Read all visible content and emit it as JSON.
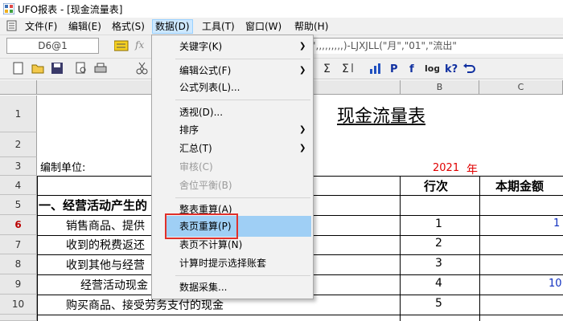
{
  "window": {
    "title": "UFO报表 - [现金流量表]"
  },
  "menubar": {
    "items": [
      "文件(F)",
      "编辑(E)",
      "格式(S)",
      "数据(D)",
      "工具(T)",
      "窗口(W)",
      "帮助(H)"
    ],
    "open_item": "数据(D)"
  },
  "formula_bar": {
    "cell_ref": "D6@1",
    "formula_text": "入\",,,,,,,,,)-LJXJLL(\"月\",\"01\",\"流出\""
  },
  "data_menu": {
    "items": [
      {
        "label": "关键字(K)",
        "submenu": true,
        "enabled": true
      },
      {
        "label": "编辑公式(F)",
        "submenu": true,
        "enabled": true
      },
      {
        "label": "公式列表(L)...",
        "submenu": false,
        "enabled": true
      },
      {
        "label": "透视(D)...",
        "submenu": false,
        "enabled": true
      },
      {
        "label": "排序",
        "submenu": true,
        "enabled": true
      },
      {
        "label": "汇总(T)",
        "submenu": true,
        "enabled": true
      },
      {
        "label": "审核(C)",
        "submenu": false,
        "enabled": false
      },
      {
        "label": "舍位平衡(B)",
        "submenu": false,
        "enabled": false
      },
      {
        "label": "整表重算(A)",
        "submenu": false,
        "enabled": true
      },
      {
        "label": "表页重算(P)",
        "submenu": false,
        "enabled": true,
        "highlighted": true
      },
      {
        "label": "表页不计算(N)",
        "submenu": false,
        "enabled": true
      },
      {
        "label": "计算时提示选择账套",
        "submenu": false,
        "enabled": true
      },
      {
        "label": "数据采集...",
        "submenu": false,
        "enabled": true
      }
    ]
  },
  "sheet": {
    "columns": [
      "B",
      "C"
    ],
    "rows": [
      "1",
      "2",
      "3",
      "4",
      "5",
      "6",
      "7",
      "8",
      "9",
      "10"
    ],
    "selected_row": "6",
    "title": "现金流量表",
    "unit_label": "编制单位:",
    "year_value": "2021",
    "year_label": "年",
    "header_line_no": "行次",
    "header_current": "本期金额",
    "section_1": "一、经营活动产生的",
    "r6_label": "销售商品、提供",
    "r7_label": "收到的税费返还",
    "r8_label": "收到其他与经营",
    "r9_label": "经营活动现金",
    "r10_label": "购买商品、接受劳务支付的现金",
    "line_nos": [
      "1",
      "2",
      "3",
      "4",
      "5"
    ],
    "r6_value": "1",
    "r9_value": "10"
  },
  "colors": {
    "accent_red": "#e0302a",
    "menu_highlight": "#9fcff5",
    "year_red": "#e00000"
  }
}
